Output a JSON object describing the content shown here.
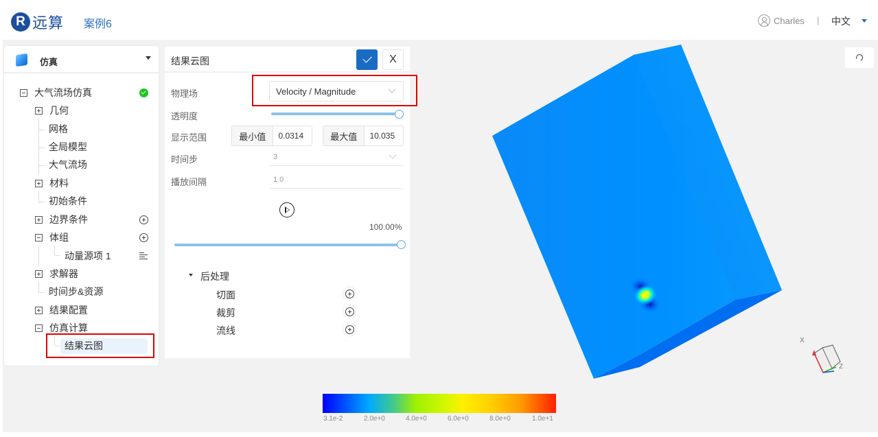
{
  "header": {
    "logo_char": "R",
    "logo_text": "远算",
    "case_name": "案例6",
    "user_name": "Charles",
    "separator": "|",
    "language": "中文"
  },
  "left_panel": {
    "title": "仿真",
    "tree": [
      {
        "label": "大气流场仿真",
        "expander": "minus",
        "status": "complete"
      },
      {
        "label": "几何",
        "expander": "plus"
      },
      {
        "label": "网格"
      },
      {
        "label": "全局模型"
      },
      {
        "label": "大气流场"
      },
      {
        "label": "材料",
        "expander": "plus"
      },
      {
        "label": "初始条件"
      },
      {
        "label": "边界条件",
        "expander": "plus",
        "action": "add"
      },
      {
        "label": "体组",
        "expander": "minus",
        "action": "add"
      },
      {
        "label": "动量源项 1",
        "action": "menu"
      },
      {
        "label": "求解器",
        "expander": "plus"
      },
      {
        "label": "时间步&资源"
      },
      {
        "label": "结果配置",
        "expander": "plus"
      },
      {
        "label": "仿真计算",
        "expander": "minus"
      },
      {
        "label": "结果云图",
        "selected": true
      }
    ]
  },
  "result_panel": {
    "title": "结果云图",
    "confirm_icon": "check-icon",
    "close_label": "X",
    "field_label": "物理场",
    "field_value": "Velocity / Magnitude",
    "opacity_label": "透明度",
    "opacity_value": 1.0,
    "range_label": "显示范围",
    "min_label": "最小值",
    "min_value": "0.0314",
    "max_label": "最大值",
    "max_value": "10.035",
    "timestep_label": "时间步",
    "timestep_value": "3",
    "interval_label": "播放间隔",
    "interval_value": "1.0",
    "progress_text": "100.00%",
    "progress_value": 1.0,
    "postprocess_title": "后处理",
    "postprocess_items": [
      "切面",
      "裁剪",
      "流线"
    ]
  },
  "viewport": {
    "colorbar_labels": [
      "3.1e-2",
      "2.0e+0",
      "4.0e+0",
      "6.0e+0",
      "8.0e+0",
      "1.0e+1"
    ],
    "axis_label_x": "X",
    "axis_label_z": "Z",
    "colors": {
      "face_main": "#0090ff",
      "face_dark": "#006ef0",
      "face_top": "#0088f8"
    }
  }
}
